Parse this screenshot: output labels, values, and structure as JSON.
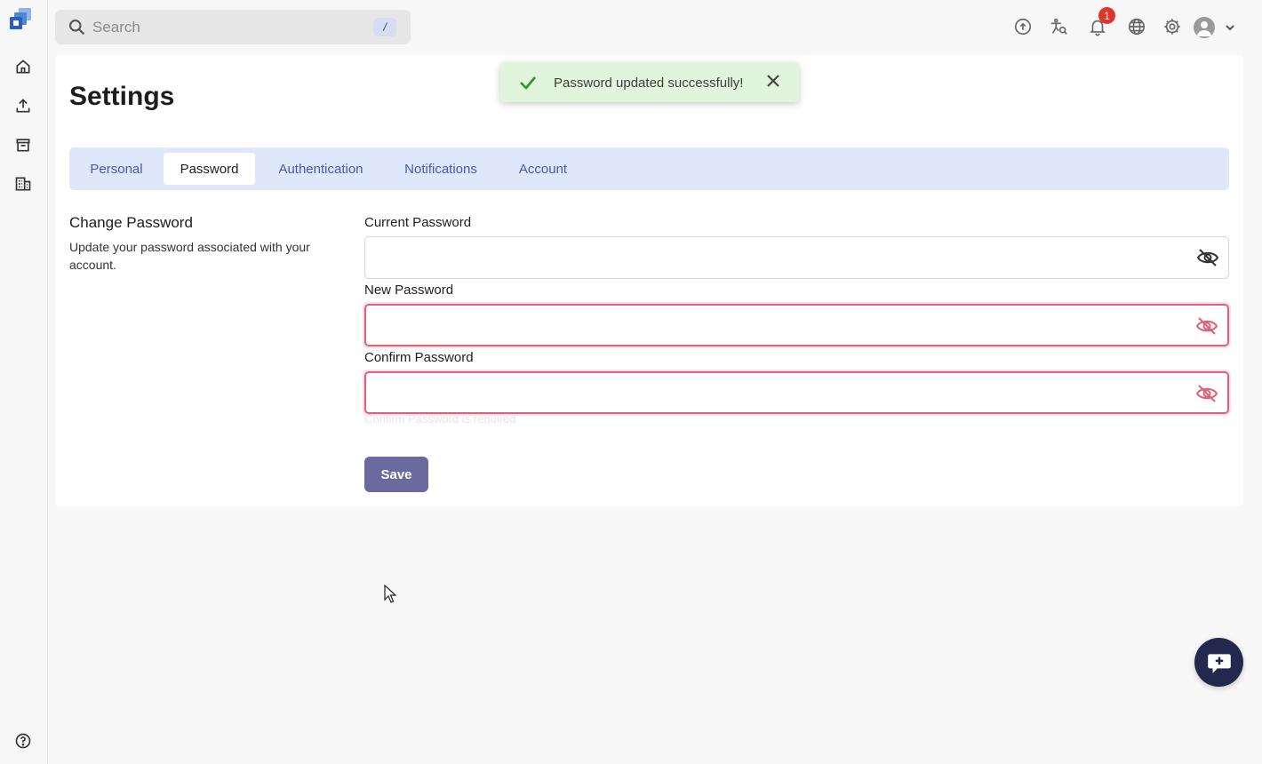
{
  "search": {
    "placeholder": "Search",
    "shortcut": "/"
  },
  "header": {
    "notification_count": "1"
  },
  "page": {
    "title": "Settings"
  },
  "tabs": [
    {
      "label": "Personal"
    },
    {
      "label": "Password"
    },
    {
      "label": "Authentication"
    },
    {
      "label": "Notifications"
    },
    {
      "label": "Account"
    }
  ],
  "section": {
    "title": "Change Password",
    "description": "Update your password associated with your account."
  },
  "fields": {
    "current": {
      "label": "Current Password",
      "value": ""
    },
    "new": {
      "label": "New Password",
      "value": ""
    },
    "confirm": {
      "label": "Confirm Password",
      "value": "",
      "error": "Confirm Password is required"
    }
  },
  "actions": {
    "save_label": "Save"
  },
  "toast": {
    "message": "Password updated successfully!"
  },
  "colors": {
    "accent": "#4b56b5",
    "tab_bar": "#dfe7fb",
    "error": "#e0607b",
    "toast_bg": "#e1f5dc",
    "success": "#3a8a3a",
    "save_button": "#6a6a9f",
    "chat_fab": "#23294e"
  }
}
